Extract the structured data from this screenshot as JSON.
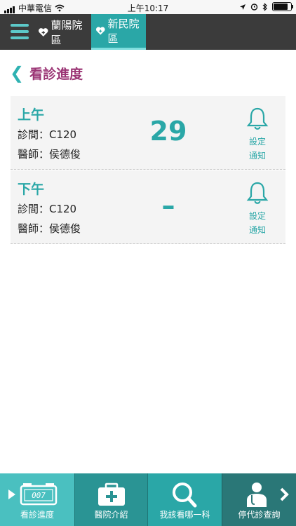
{
  "statusbar": {
    "carrier": "中華電信",
    "time": "上午10:17"
  },
  "topbar": {
    "tabs": [
      {
        "label": "蘭陽院區"
      },
      {
        "label": "新民院區"
      }
    ]
  },
  "page": {
    "title": "看診進度"
  },
  "cards": [
    {
      "session": "上午",
      "room": "診間：C120",
      "doctor": "醫師：侯德俊",
      "number": "29",
      "notify_1": "設定",
      "notify_2": "通知"
    },
    {
      "session": "下午",
      "room": "診間：C120",
      "doctor": "醫師：侯德俊",
      "number": "–",
      "notify_1": "設定",
      "notify_2": "通知"
    }
  ],
  "bottom_nav": [
    {
      "label": "看診進度",
      "icon": "clock-icon",
      "clock_text": "007"
    },
    {
      "label": "醫院介紹",
      "icon": "medical-kit-icon"
    },
    {
      "label": "我該看哪一科",
      "icon": "search-icon"
    },
    {
      "label": "停代診查詢",
      "icon": "doctor-icon"
    }
  ]
}
